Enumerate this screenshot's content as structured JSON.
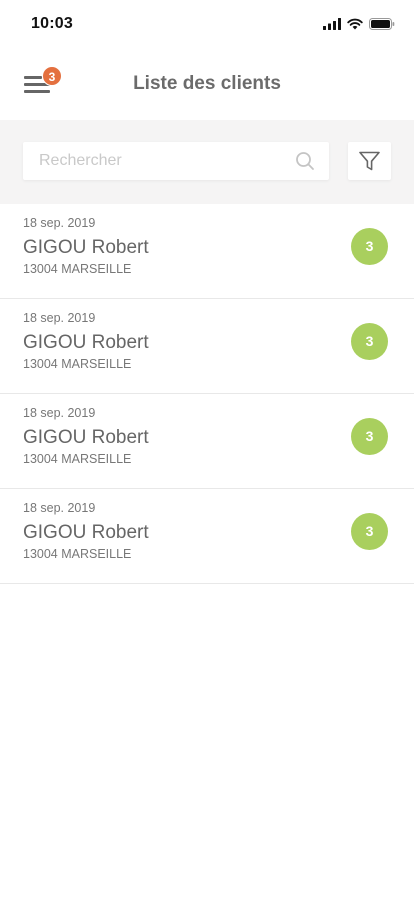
{
  "status_bar": {
    "time": "10:03",
    "icons": [
      "signal-icon",
      "wifi-icon",
      "battery-icon"
    ]
  },
  "header": {
    "title": "Liste des clients",
    "menu_badge_count": "3",
    "menu_icon": "menu-icon"
  },
  "search": {
    "placeholder": "Rechercher",
    "value": "",
    "icon": "search-icon",
    "filter_icon": "filter-icon"
  },
  "clients": [
    {
      "date": "18 sep. 2019",
      "name": "GIGOU Robert",
      "city": "13004 MARSEILLE",
      "count": "3"
    },
    {
      "date": "18 sep. 2019",
      "name": "GIGOU Robert",
      "city": "13004 MARSEILLE",
      "count": "3"
    },
    {
      "date": "18 sep. 2019",
      "name": "GIGOU Robert",
      "city": "13004 MARSEILLE",
      "count": "3"
    },
    {
      "date": "18 sep. 2019",
      "name": "GIGOU Robert",
      "city": "13004 MARSEILLE",
      "count": "3"
    }
  ],
  "colors": {
    "badge_orange": "#e4703f",
    "badge_green": "#a9cf5e",
    "search_area_bg": "#f5f4f4"
  }
}
